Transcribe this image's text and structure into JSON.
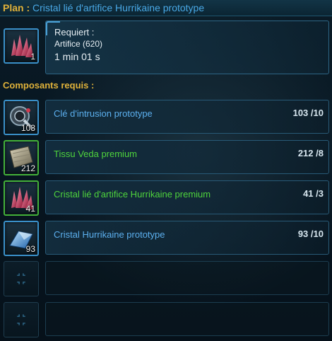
{
  "header": {
    "prefix": "Plan :",
    "schematic_name": "Cristal lié d'artifice Hurrikaine prototype"
  },
  "requirements": {
    "title": "Requiert :",
    "skill": "Artifice (620)",
    "time": "1 min 01 s",
    "result_qty": "1",
    "result_icon": "red-crystal-icon"
  },
  "components_label": "Composants requis :",
  "components": [
    {
      "name": "Clé d'intrusion prototype",
      "owned": "103",
      "required": "10",
      "slot_qty": "103",
      "color": "#5cb0ef",
      "icon": "intrusion-key-icon"
    },
    {
      "name": "Tissu Veda premium",
      "owned": "212",
      "required": "8",
      "slot_qty": "212",
      "color": "#4fd43c",
      "icon": "fabric-icon"
    },
    {
      "name": "Cristal lié d'artifice Hurrikaine premium",
      "owned": "41",
      "required": "3",
      "slot_qty": "41",
      "color": "#4fd43c",
      "icon": "red-crystal-icon"
    },
    {
      "name": "Cristal Hurrikaine prototype",
      "owned": "93",
      "required": "10",
      "slot_qty": "93",
      "color": "#5cb0ef",
      "icon": "blue-crystal-icon"
    }
  ]
}
